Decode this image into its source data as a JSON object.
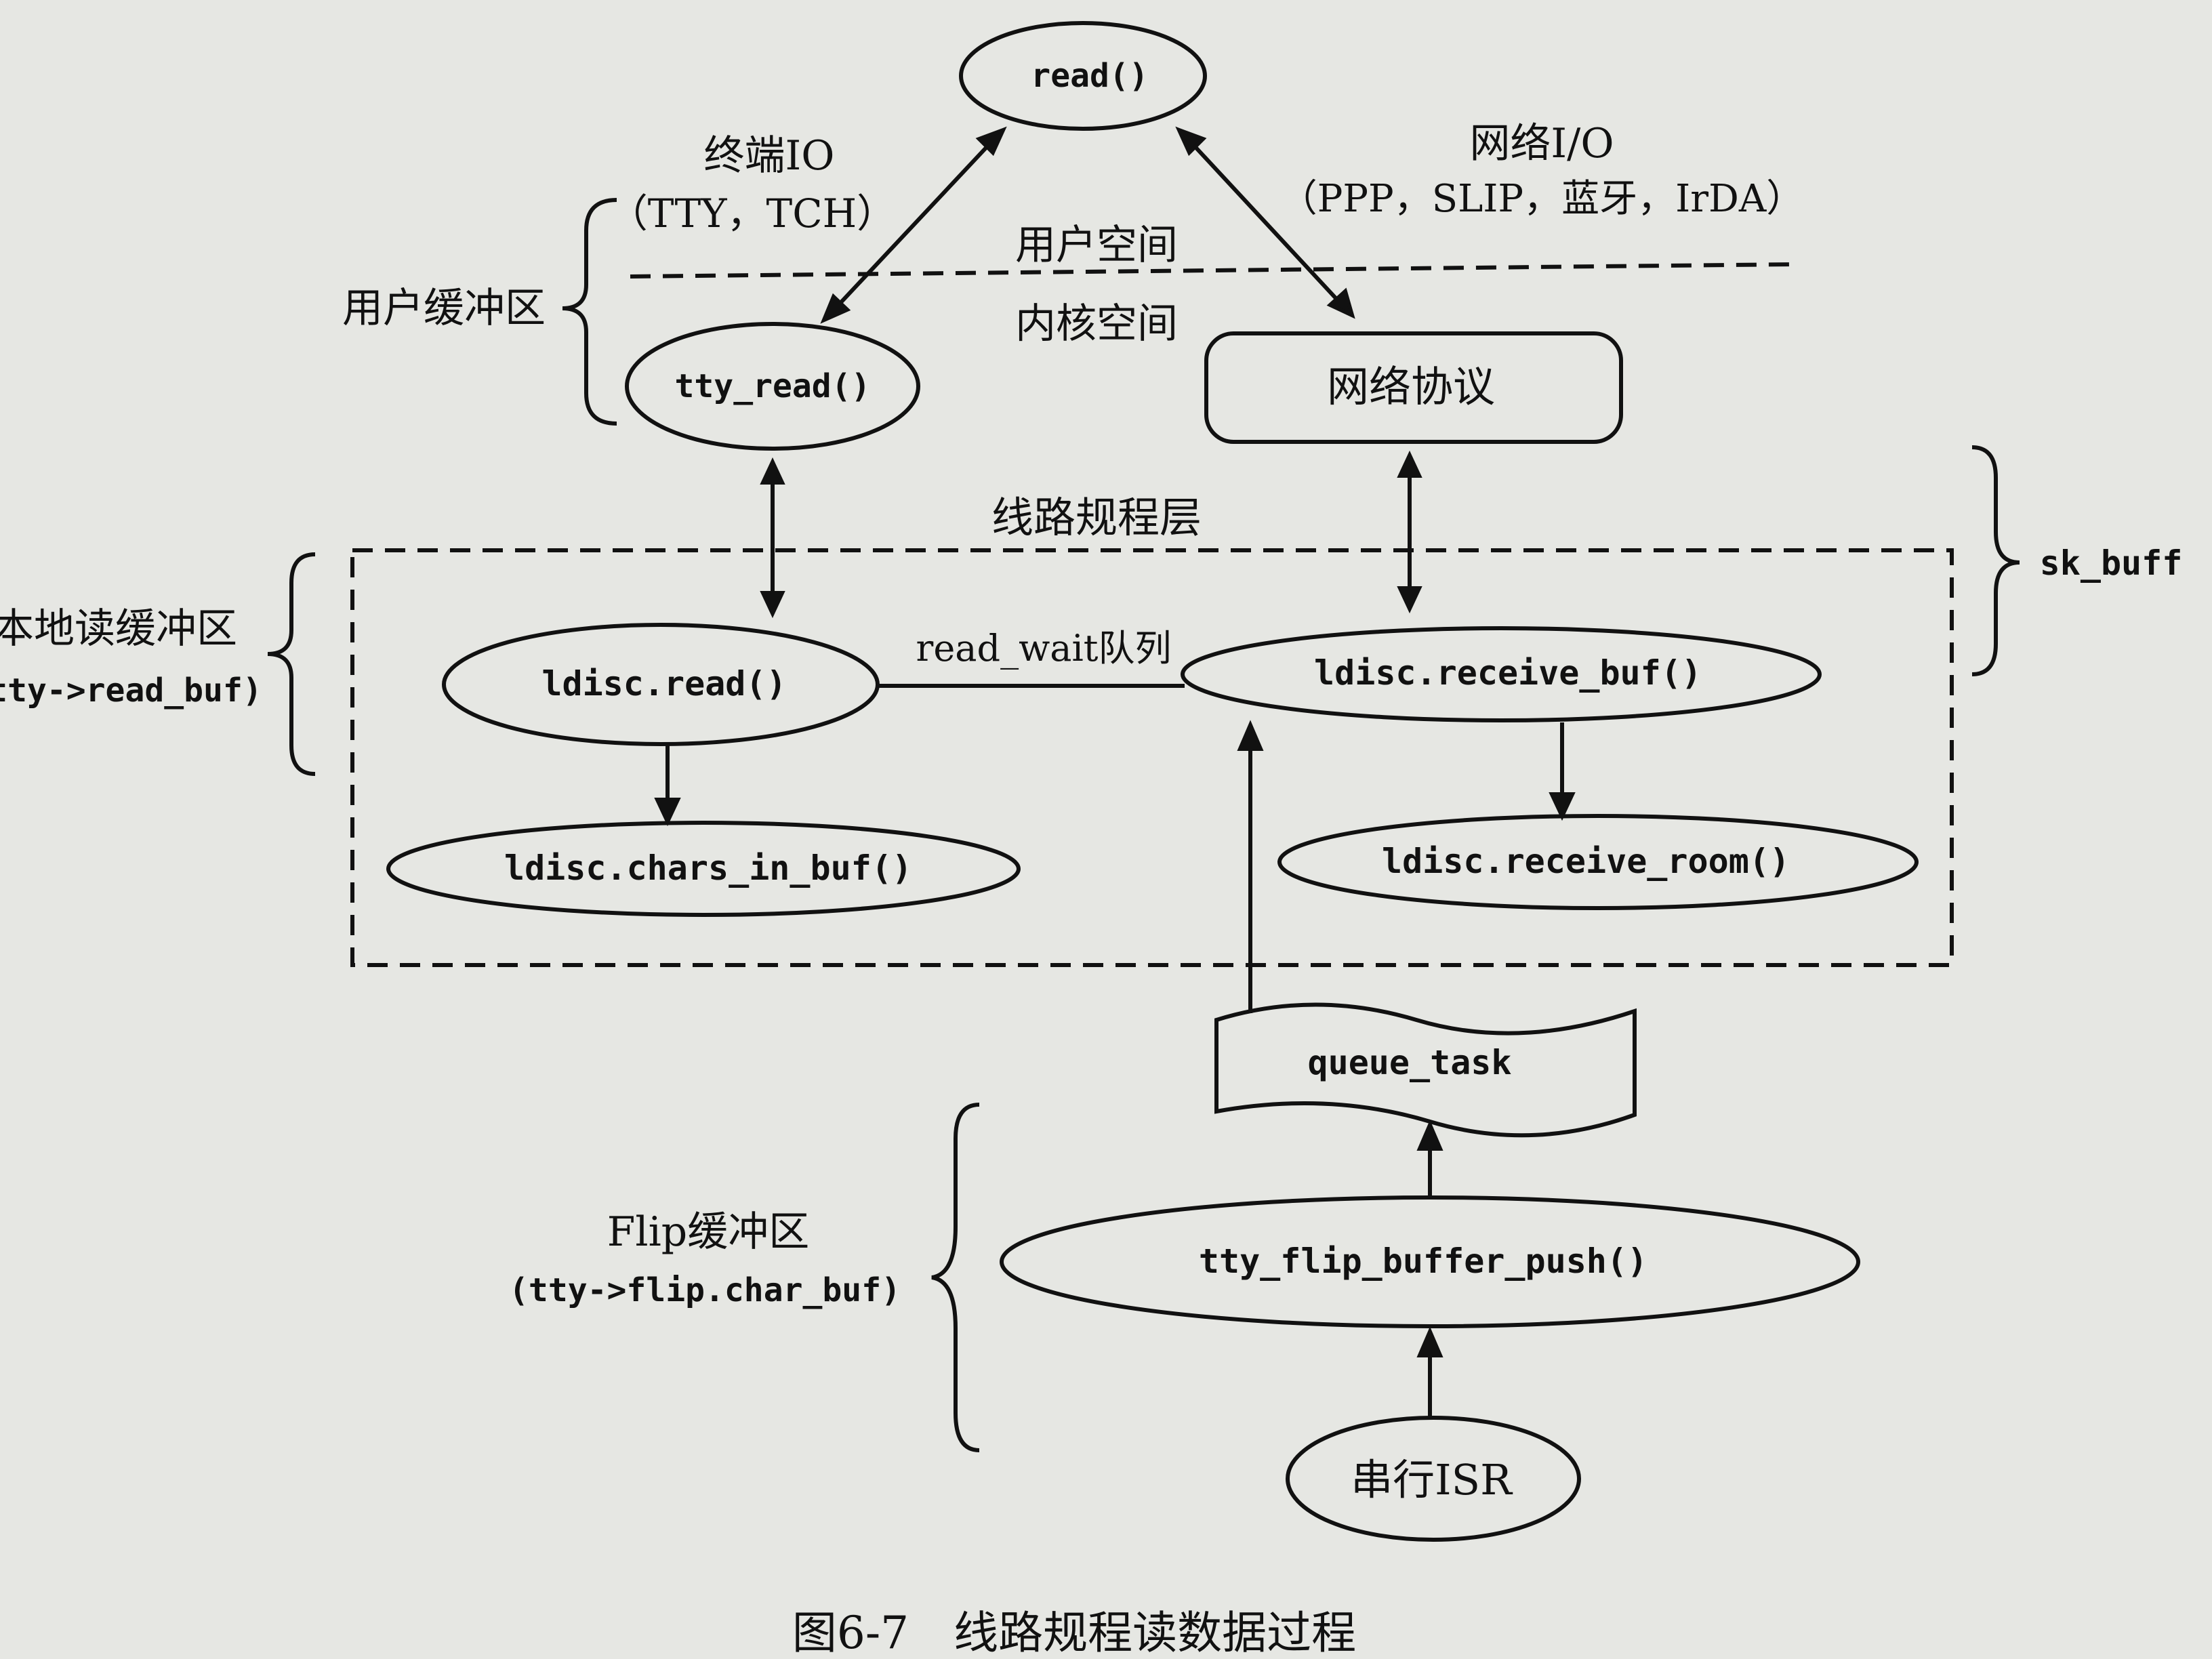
{
  "nodes": {
    "read": "read()",
    "tty_read": "tty_read()",
    "net_protocol": "网络协议",
    "ldisc_read": "ldisc.read()",
    "ldisc_receive_buf": "ldisc.receive_buf()",
    "ldisc_chars_in_buf": "ldisc.chars_in_buf()",
    "ldisc_receive_room": "ldisc.receive_room()",
    "queue_task": "queue_task",
    "flip_push": "tty_flip_buffer_push()",
    "serial_isr": "串行ISR"
  },
  "labels": {
    "terminal_io": "终端IO",
    "terminal_io_sub": "（TTY，TCH）",
    "net_io": "网络I/O",
    "net_io_sub": "（PPP，SLIP，蓝牙，IrDA）",
    "user_space": "用户空间",
    "kernel_space": "内核空间",
    "line_discipline_layer": "线路规程层",
    "read_wait_queue": "read_wait队列",
    "user_buffer": "用户缓冲区",
    "local_read_buffer": "本地读缓冲区",
    "local_read_buffer_sub": "(tty->read_buf)",
    "sk_buff": "sk_buff",
    "flip_buffer": "Flip缓冲区",
    "flip_buffer_sub": "(tty->flip.char_buf)"
  },
  "caption": "图6-7　线路规程读数据过程"
}
